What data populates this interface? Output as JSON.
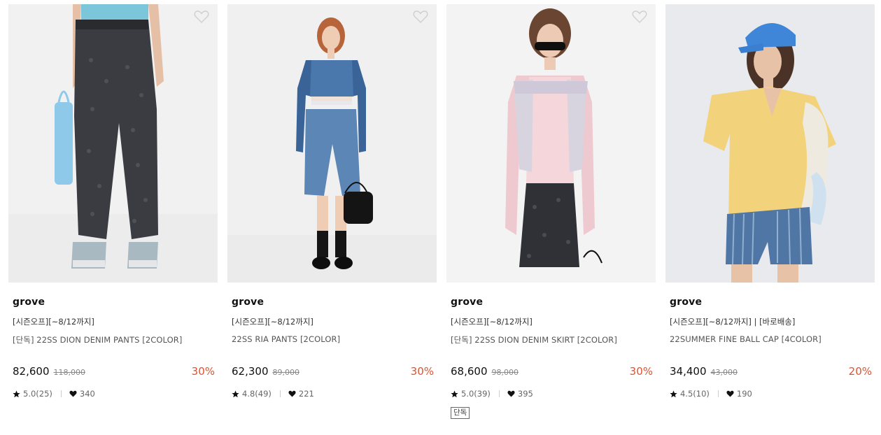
{
  "products": [
    {
      "brand": "grove",
      "promo": "[시즌오프][~8/12까지]",
      "name": "[단독] 22SS DION DENIM PANTS [2COLOR]",
      "price": "82,600",
      "original_price": "118,000",
      "discount": "30%",
      "rating": "5.0(25)",
      "likes": "340",
      "tag": ""
    },
    {
      "brand": "grove",
      "promo": "[시즌오프][~8/12까지]",
      "name": "22SS RIA PANTS [2COLOR]",
      "price": "62,300",
      "original_price": "89,000",
      "discount": "30%",
      "rating": "4.8(49)",
      "likes": "221",
      "tag": ""
    },
    {
      "brand": "grove",
      "promo": "[시즌오프][~8/12까지]",
      "name": "[단독] 22SS DION DENIM SKIRT [2COLOR]",
      "price": "68,600",
      "original_price": "98,000",
      "discount": "30%",
      "rating": "5.0(39)",
      "likes": "395",
      "tag": "단독"
    },
    {
      "brand": "grove",
      "promo": "[시즌오프][~8/12까지] | [바로배송]",
      "name": "22SUMMER FINE BALL CAP [4COLOR]",
      "price": "34,400",
      "original_price": "43,000",
      "discount": "20%",
      "rating": "4.5(10)",
      "likes": "190",
      "tag": ""
    }
  ],
  "colors": {
    "discount": "#e0522f",
    "text": "#222222",
    "muted": "#888888"
  }
}
